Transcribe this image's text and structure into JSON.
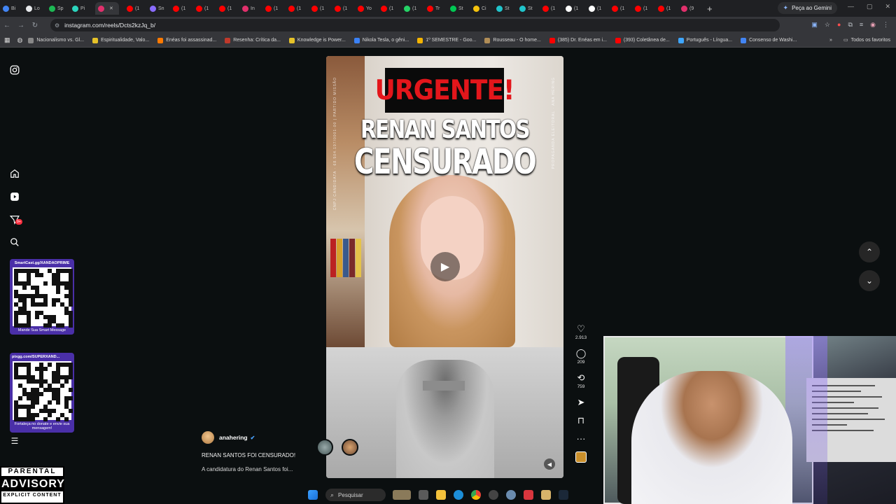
{
  "browser": {
    "tabs": [
      {
        "label": "Bi",
        "color": "#4285f4"
      },
      {
        "label": "Lo",
        "color": "#e8eaed"
      },
      {
        "label": "Sp",
        "color": "#1db954"
      },
      {
        "label": "Pi",
        "color": "#2bd4bd"
      },
      {
        "label": "",
        "color": "#e1306c",
        "active": true
      },
      {
        "label": "(1",
        "color": "#ff0000"
      },
      {
        "label": "Sn",
        "color": "#8a6cff"
      },
      {
        "label": "(1",
        "color": "#ff0000"
      },
      {
        "label": "(1",
        "color": "#ff0000"
      },
      {
        "label": "(1",
        "color": "#ff0000"
      },
      {
        "label": "In",
        "color": "#e1306c"
      },
      {
        "label": "(1",
        "color": "#ff0000"
      },
      {
        "label": "(1",
        "color": "#ff0000"
      },
      {
        "label": "(1",
        "color": "#ff0000"
      },
      {
        "label": "(1",
        "color": "#ff0000"
      },
      {
        "label": "Yo",
        "color": "#ff0000"
      },
      {
        "label": "(1",
        "color": "#ff0000"
      },
      {
        "label": "(1",
        "color": "#25d366"
      },
      {
        "label": "Tr",
        "color": "#ff0000"
      },
      {
        "label": "St",
        "color": "#00c853"
      },
      {
        "label": "Ci",
        "color": "#f4c20d"
      },
      {
        "label": "St",
        "color": "#20c4cb"
      },
      {
        "label": "St",
        "color": "#20c4cb"
      },
      {
        "label": "(1",
        "color": "#ff0000"
      },
      {
        "label": "(1",
        "color": "#ffffff"
      },
      {
        "label": "(1",
        "color": "#ffffff"
      },
      {
        "label": "(1",
        "color": "#ff0000"
      },
      {
        "label": "(1",
        "color": "#ff0000"
      },
      {
        "label": "(1",
        "color": "#ff0000"
      },
      {
        "label": "(9",
        "color": "#e1306c"
      }
    ],
    "new_tab": "+",
    "gemini_label": "Peça ao Gemini",
    "url": "instagram.com/reels/Dcts2kzJq_b/",
    "bookmarks": [
      {
        "label": "Nacionalismo vs. Gl...",
        "color": "#888"
      },
      {
        "label": "Espiritualidade, Valo...",
        "color": "#e6c229"
      },
      {
        "label": "Enéas foi assassinad...",
        "color": "#ff7a00"
      },
      {
        "label": "Resenha: Crítica da...",
        "color": "#c0392b"
      },
      {
        "label": "Knowledge is Power...",
        "color": "#e6c229"
      },
      {
        "label": "Nikola Tesla, o gêni...",
        "color": "#3b82f6"
      },
      {
        "label": "1º SEMESTRE - Goo...",
        "color": "#f4b400"
      },
      {
        "label": "Rousseau - O home...",
        "color": "#b08d57"
      },
      {
        "label": "(385) Dr. Enéas em i...",
        "color": "#ff0000"
      },
      {
        "label": "(393) Coletânea de...",
        "color": "#ff0000"
      },
      {
        "label": "Português - Língua...",
        "color": "#3ea6ff"
      },
      {
        "label": "Consenso de Washi...",
        "color": "#4285f4"
      }
    ],
    "all_bookmarks": "Todos os favoritos"
  },
  "overlay": {
    "card1_top": "SmartCast.gg/XANDAOPRIME",
    "card1_bottom": "Mande Sua Smart Message",
    "card2_top": "pixgg.com/SUPERXAND...",
    "card2_bottom": "Fortaleça no donate e envie sua mensagem!",
    "advisory_line1": "PARENTAL",
    "advisory_line2": "ADVISORY",
    "advisory_line3": "EXPLICIT CONTENT"
  },
  "sidebar": {
    "notifications_badge": "9+"
  },
  "reel": {
    "banner": "URGENTE!",
    "headline_line1": "RENAN SANTOS",
    "headline_line2": "CENSURADO",
    "side_text": "CNPJ CANDIDATA · 68.504.197/0001-00 | PARTIDO MISSÃO",
    "side_text_right": "PROPAGANDA ELEITORAL · ANA HERING",
    "author": "anahering",
    "caption_title": "RENAN SANTOS FOI CENSURADO!",
    "caption_preview": "A candidatura do Renan Santos foi...",
    "likes": "2.913",
    "comments": "209",
    "reposts": "759"
  },
  "taskbar": {
    "search_label": "Pesquisar"
  }
}
